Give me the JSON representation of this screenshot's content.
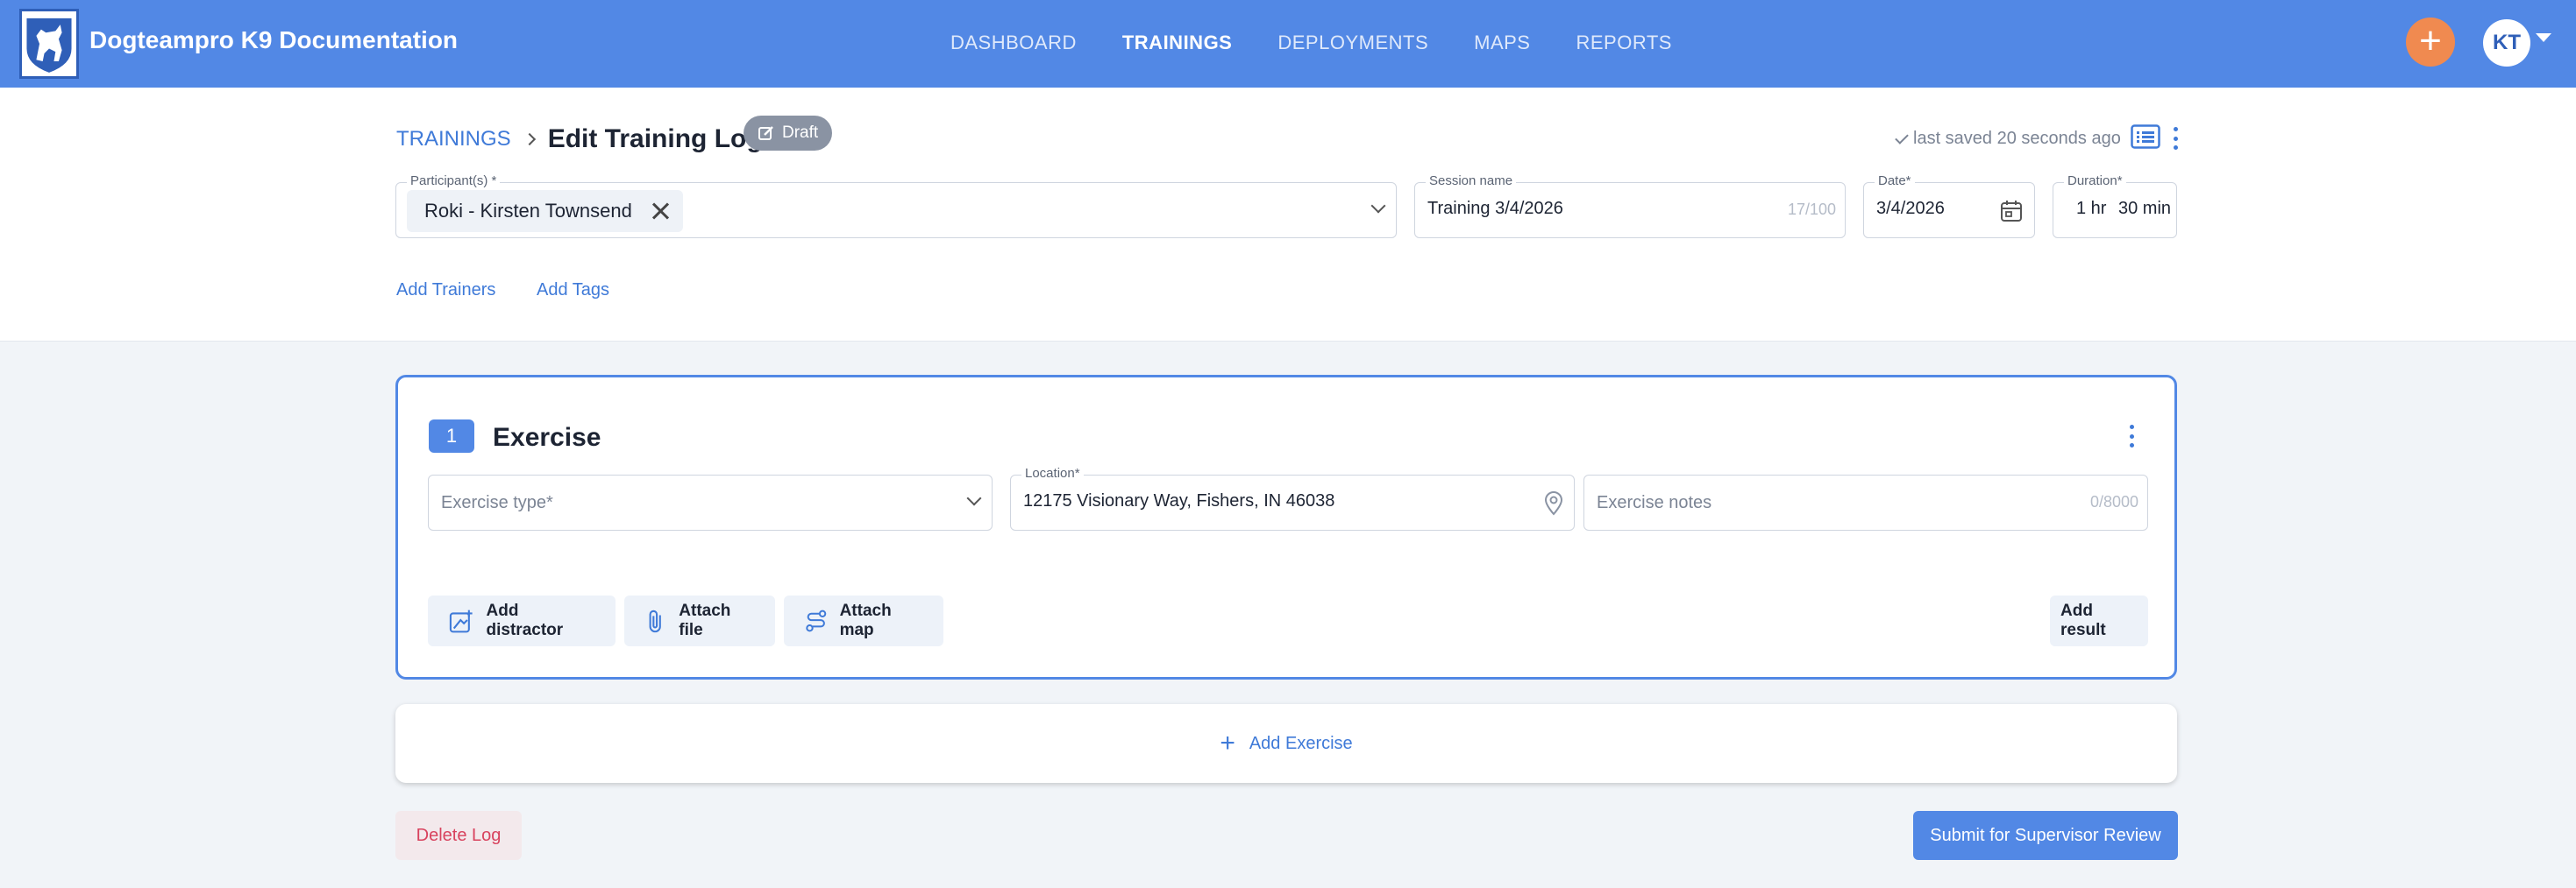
{
  "app": {
    "title": "Dogteampro K9 Documentation",
    "user_initials": "KT"
  },
  "nav": {
    "items": [
      {
        "label": "DASHBOARD",
        "active": false
      },
      {
        "label": "TRAININGS",
        "active": true
      },
      {
        "label": "DEPLOYMENTS",
        "active": false
      },
      {
        "label": "MAPS",
        "active": false
      },
      {
        "label": "REPORTS",
        "active": false
      }
    ],
    "add_button": "+"
  },
  "header": {
    "breadcrumb_link": "TRAININGS",
    "page_title": "Edit Training Log",
    "status_badge": "Draft",
    "saved_status": "last saved 20 seconds ago"
  },
  "form": {
    "participants_label": "Participant(s) *",
    "participant_chip": "Roki - Kirsten Townsend",
    "session_name_label": "Session name",
    "session_name_value": "Training 3/4/2026",
    "session_name_counter": "17/100",
    "date_label": "Date*",
    "date_value": "3/4/2026",
    "duration_label": "Duration*",
    "duration_hours": "1 hr",
    "duration_minutes": "30 min",
    "add_trainers": "Add Trainers",
    "add_tags": "Add Tags"
  },
  "exercise": {
    "number": "1",
    "title": "Exercise",
    "type_placeholder": "Exercise type*",
    "location_label": "Location*",
    "location_value": "12175 Visionary Way, Fishers, IN 46038",
    "notes_placeholder": "Exercise notes",
    "notes_counter": "0/8000",
    "add_distractor": "Add distractor",
    "attach_file": "Attach file",
    "attach_map": "Attach map",
    "add_result": "Add result"
  },
  "footer": {
    "add_exercise": "Add Exercise",
    "delete_log": "Delete Log",
    "submit": "Submit for Supervisor Review"
  },
  "colors": {
    "primary": "#5288e5",
    "accent": "#f08a50",
    "danger": "#d8435e",
    "badge": "#8a93a3"
  },
  "icons": [
    "dog-shield-logo-icon",
    "plus-icon",
    "chevron-down-icon",
    "edit-icon",
    "check-icon",
    "list-icon",
    "more-vertical-icon",
    "close-icon",
    "calendar-icon",
    "location-pin-icon",
    "distractor-icon",
    "paperclip-icon",
    "route-map-icon"
  ]
}
